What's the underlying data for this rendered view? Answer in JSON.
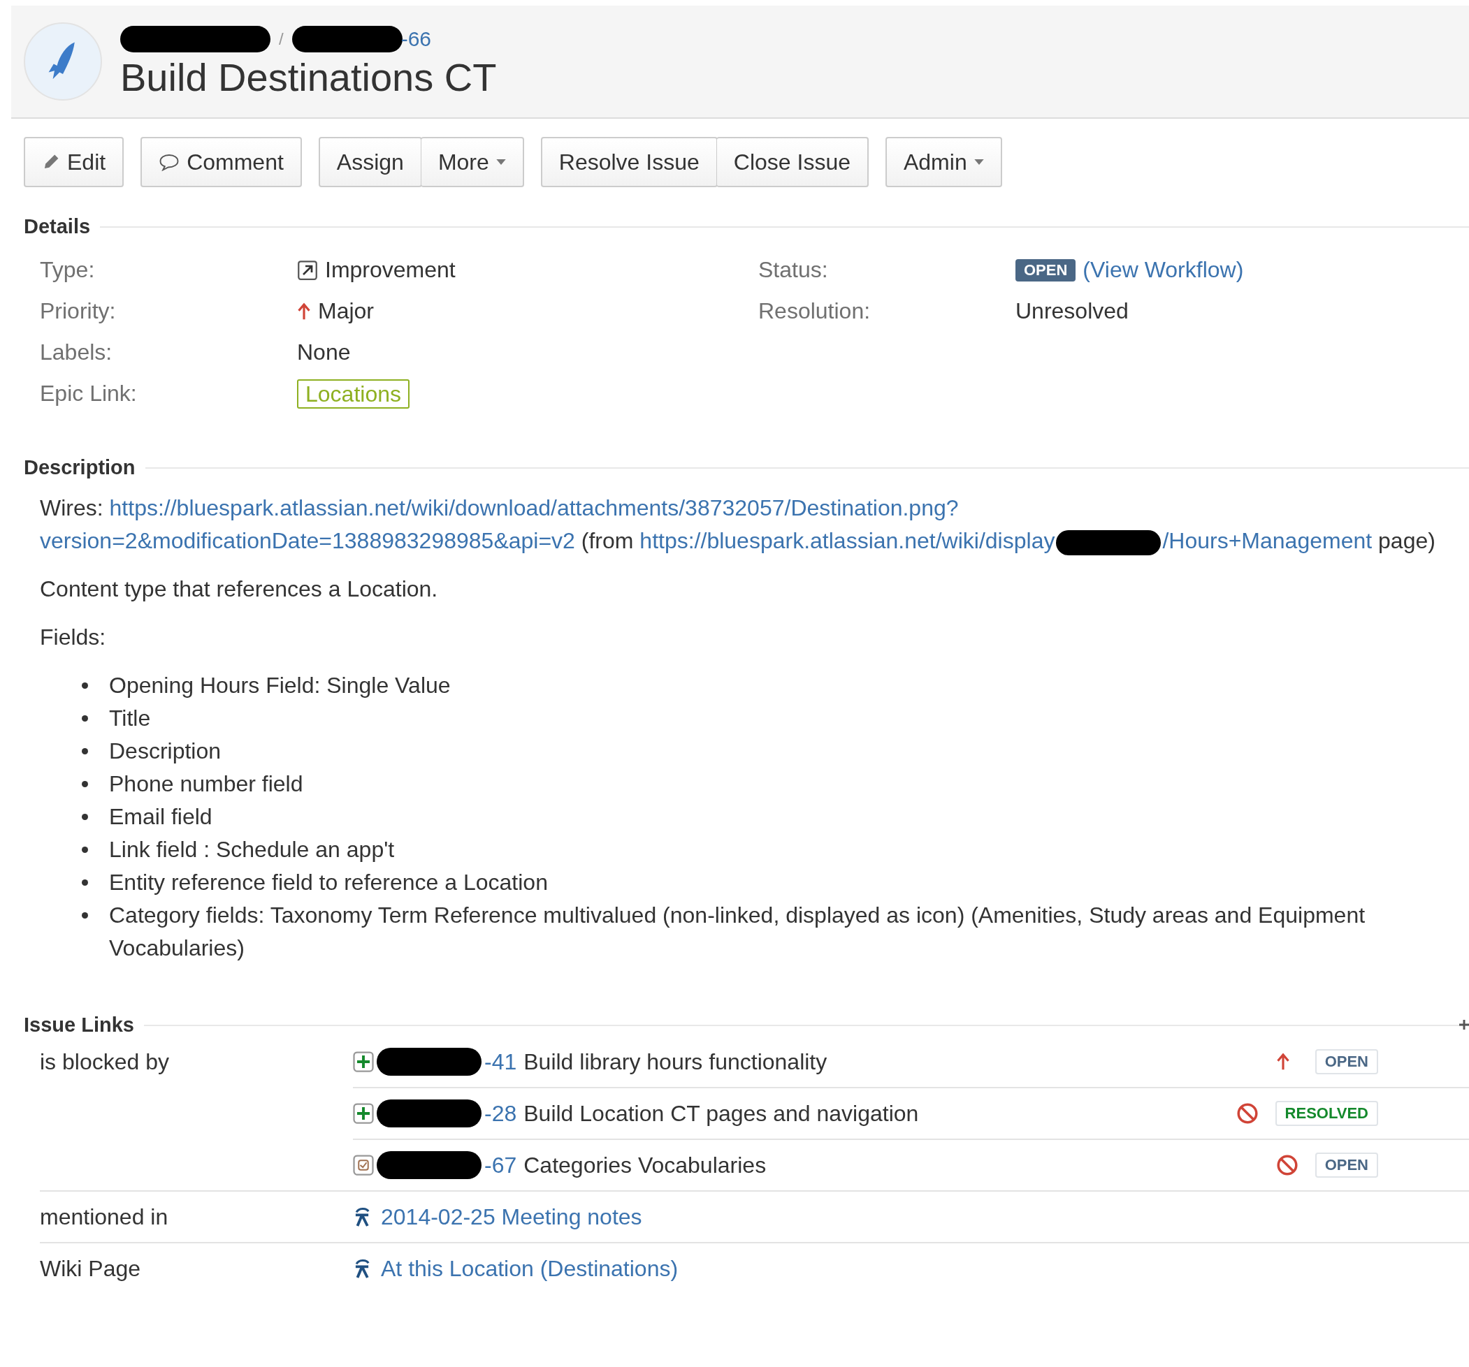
{
  "header": {
    "breadcrumb_separator": "/",
    "issue_key": "-66",
    "title": "Build Destinations CT"
  },
  "toolbar": [
    {
      "buttons": [
        {
          "label": "Edit",
          "kind": "edit"
        }
      ]
    },
    {
      "buttons": [
        {
          "label": "Comment",
          "kind": "comment"
        }
      ]
    },
    {
      "buttons": [
        {
          "label": "Assign",
          "kind": "plain"
        },
        {
          "label": "More",
          "kind": "dropdown"
        }
      ]
    },
    {
      "buttons": [
        {
          "label": "Resolve Issue",
          "kind": "plain"
        },
        {
          "label": "Close Issue",
          "kind": "plain"
        }
      ]
    },
    {
      "buttons": [
        {
          "label": "Admin",
          "kind": "dropdown"
        }
      ]
    }
  ],
  "details": {
    "heading": "Details",
    "left": [
      {
        "label": "Type:",
        "kind": "type",
        "value": "Improvement"
      },
      {
        "label": "Priority:",
        "kind": "priority",
        "value": "Major"
      },
      {
        "label": "Labels:",
        "kind": "text",
        "value": "None"
      },
      {
        "label": "Epic Link:",
        "kind": "epic",
        "value": "Locations"
      }
    ],
    "right": [
      {
        "label": "Status:",
        "kind": "status",
        "value": "OPEN",
        "link": "(View Workflow)"
      },
      {
        "label": "Resolution:",
        "kind": "text",
        "value": "Unresolved"
      }
    ]
  },
  "description": {
    "heading": "Description",
    "wires": [
      {
        "kind": "text",
        "text": "Wires: "
      },
      {
        "kind": "link",
        "text": "https://bluespark.atlassian.net/wiki/download/attachments/38732057/Destination.png?"
      },
      {
        "kind": "link",
        "text": "version=2&modificationDate=1388983298985&api=v2"
      },
      {
        "kind": "text",
        "text": " (from "
      },
      {
        "kind": "link",
        "text": "https://bluespark.atlassian.net/wiki/display"
      },
      {
        "kind": "redaction"
      },
      {
        "kind": "link",
        "text": "/Hours+Management"
      },
      {
        "kind": "text",
        "text": " page)"
      }
    ],
    "paragraphs": [
      "Content type that references a Location.",
      "Fields:"
    ],
    "fields": [
      "Opening Hours Field: Single Value",
      "Title",
      "Description",
      "Phone number field",
      "Email field",
      "Link field : Schedule an app't",
      "Entity reference field to reference a Location",
      "Category fields: Taxonomy Term Reference multivalued (non-linked, displayed as icon) (Amenities, Study areas and Equipment Vocabularies)"
    ]
  },
  "issue_links": {
    "heading": "Issue Links",
    "groups": [
      {
        "relation": "is blocked by",
        "items": [
          {
            "kind": "issue",
            "type_icon": {
              "kind": "new-feature"
            },
            "key": "-41",
            "summary": "Build library hours functionality",
            "priority_icon": {
              "kind": "major"
            },
            "status": {
              "text": "OPEN",
              "color": "#4a6785"
            }
          },
          {
            "kind": "issue",
            "type_icon": {
              "kind": "new-feature"
            },
            "key": "-28",
            "summary": "Build Location CT pages and navigation",
            "priority_icon": {
              "kind": "blocker"
            },
            "status": {
              "text": "RESOLVED",
              "color": "#14892c"
            }
          },
          {
            "kind": "issue",
            "type_icon": {
              "kind": "task"
            },
            "key": "-67",
            "summary": "Categories Vocabularies",
            "priority_icon": {
              "kind": "blocker"
            },
            "status": {
              "text": "OPEN",
              "color": "#4a6785"
            }
          }
        ]
      },
      {
        "relation": "mentioned in",
        "items": [
          {
            "kind": "wiki",
            "title": "2014-02-25 Meeting notes"
          }
        ]
      },
      {
        "relation": "Wiki Page",
        "items": [
          {
            "kind": "wiki",
            "title": "At this Location (Destinations)"
          }
        ]
      }
    ]
  }
}
